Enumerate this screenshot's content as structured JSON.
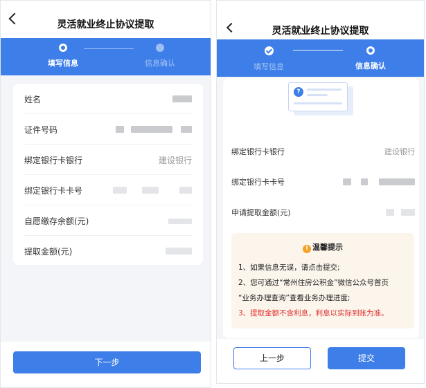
{
  "left": {
    "title": "灵活就业终止协议提取",
    "steps": [
      {
        "label": "填写信息",
        "state": "active"
      },
      {
        "label": "信息确认",
        "state": "inactive"
      }
    ],
    "fields": [
      {
        "label": "姓名",
        "value": ""
      },
      {
        "label": "证件号码",
        "value": ""
      },
      {
        "label": "绑定银行卡银行",
        "value": "建设银行"
      },
      {
        "label": "绑定银行卡卡号",
        "value": ""
      },
      {
        "label": "自愿缴存余额(元)",
        "value": ""
      },
      {
        "label": "提取金额(元)",
        "value": ""
      }
    ],
    "next_button": "下一步"
  },
  "right": {
    "title": "灵活就业终止协议提取",
    "steps": [
      {
        "label": "填写信息",
        "state": "done"
      },
      {
        "label": "信息确认",
        "state": "active"
      }
    ],
    "fields": [
      {
        "label": "绑定银行卡银行",
        "value": "建设银行"
      },
      {
        "label": "绑定银行卡卡号",
        "value": ""
      },
      {
        "label": "申请提取金额(元)",
        "value": ""
      }
    ],
    "tips": {
      "title": "温馨提示",
      "icon": "!",
      "lines": [
        "1、如果信息无误，请点击提交;",
        "2、您可通过“常州住房公积金”微信公众号首页",
        "“业务办理查询”查看业务办理进度;",
        "3、提取金额不含利息，利息以实际到账为准。"
      ]
    },
    "prev_button": "上一步",
    "submit_button": "提交"
  },
  "colors": {
    "primary": "#3d7ee8",
    "warning": "#f3a024",
    "danger": "#e02e2e",
    "tips_bg": "#fbf5ec"
  },
  "icons": {
    "back": "chevron-left-icon",
    "done": "check-icon",
    "info": "question-icon",
    "warn": "exclamation-icon"
  }
}
